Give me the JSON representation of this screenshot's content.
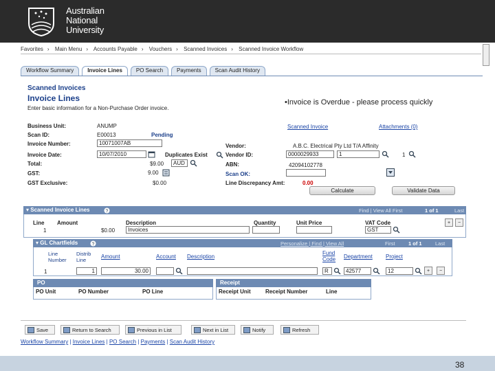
{
  "header": {
    "university_line1": "Australian",
    "university_line2": "National",
    "university_line3": "University"
  },
  "breadcrumb": [
    "Favorites",
    "Main Menu",
    "Accounts Payable",
    "Vouchers",
    "Scanned Invoices",
    "Scanned Invoice Workflow"
  ],
  "tabs": [
    "Workflow Summary",
    "Invoice Lines",
    "PO Search",
    "Payments",
    "Scan Audit History"
  ],
  "page": {
    "title_small": "Scanned Invoices",
    "title": "Invoice Lines",
    "subtitle": "Enter basic information for a Non-Purchase Order invoice.",
    "notice": "•Invoice is Overdue - please process quickly"
  },
  "form": {
    "business_unit_label": "Business Unit:",
    "business_unit": "ANUMP",
    "scan_id_label": "Scan ID:",
    "scan_id": "E00013",
    "scan_status": "Pending",
    "invoice_number_label": "Invoice Number:",
    "invoice_number": "10071007AB",
    "invoice_date_label": "Invoice Date:",
    "invoice_date": "10/07/2010",
    "duplicates": "Duplicates Exist",
    "total_label": "Total:",
    "total": "$9.00",
    "currency": "AUD",
    "gst_label": "GST:",
    "gst": "9.00",
    "gst_exclusive_label": "GST Exclusive:",
    "gst_exclusive": "$0.00",
    "scanned_invoice_link": "Scanned Invoice",
    "attachments_link": "Attachments (0)",
    "vendor_label": "Vendor:",
    "vendor_name": "A.B.C. Electrical Pty Ltd T/A Affinity",
    "vendor_id_label": "Vendor ID:",
    "vendor_id": "0000029933",
    "vendor_loc": "1",
    "vendor_seq": "1",
    "abn_label": "ABN:",
    "abn": "42094102778",
    "scan_ok_label": "Scan OK:",
    "line_disc_label": "Line Discrepancy Amt:",
    "line_disc": "0.00",
    "calculate_btn": "Calculate",
    "validate_btn": "Validate Data"
  },
  "lines_grid": {
    "title": "Scanned Invoice Lines",
    "nav": "Find | View All  First",
    "count": "1 of 1",
    "last": "Last",
    "headers": [
      "Line",
      "Amount",
      "Description",
      "Quantity",
      "Unit Price",
      "VAT Code"
    ],
    "row": {
      "line": "1",
      "amount": "$0.00",
      "description": "Invoices",
      "vat": "GST"
    }
  },
  "cf_grid": {
    "title": "GL Chartfields",
    "nav_links": "Personalize | Find | View All",
    "first": "First",
    "count": "1 of 1",
    "last": "Last",
    "headers": [
      "Line Number",
      "Distrib Line",
      "Amount",
      "Account",
      "Description",
      "Fund Code",
      "Department",
      "Project"
    ],
    "row": {
      "line": "1",
      "distrib": "1",
      "amount": "30.00",
      "account": "",
      "description": "",
      "fund": "R",
      "dept": "42577",
      "project": "12"
    }
  },
  "po_box": {
    "title": "PO",
    "headers": [
      "PO Unit",
      "PO Number",
      "PO Line"
    ]
  },
  "receipt_box": {
    "title": "Receipt",
    "headers": [
      "Receipt Unit",
      "Receipt Number",
      "Line"
    ]
  },
  "toolbar": [
    "Save",
    "Return to Search",
    "Previous in List",
    "Next in List",
    "Notify",
    "Refresh"
  ],
  "footer_links": [
    "Workflow Summary",
    "Invoice Lines",
    "PO Search",
    "Payments",
    "Scan Audit History"
  ],
  "slide_number": "38"
}
